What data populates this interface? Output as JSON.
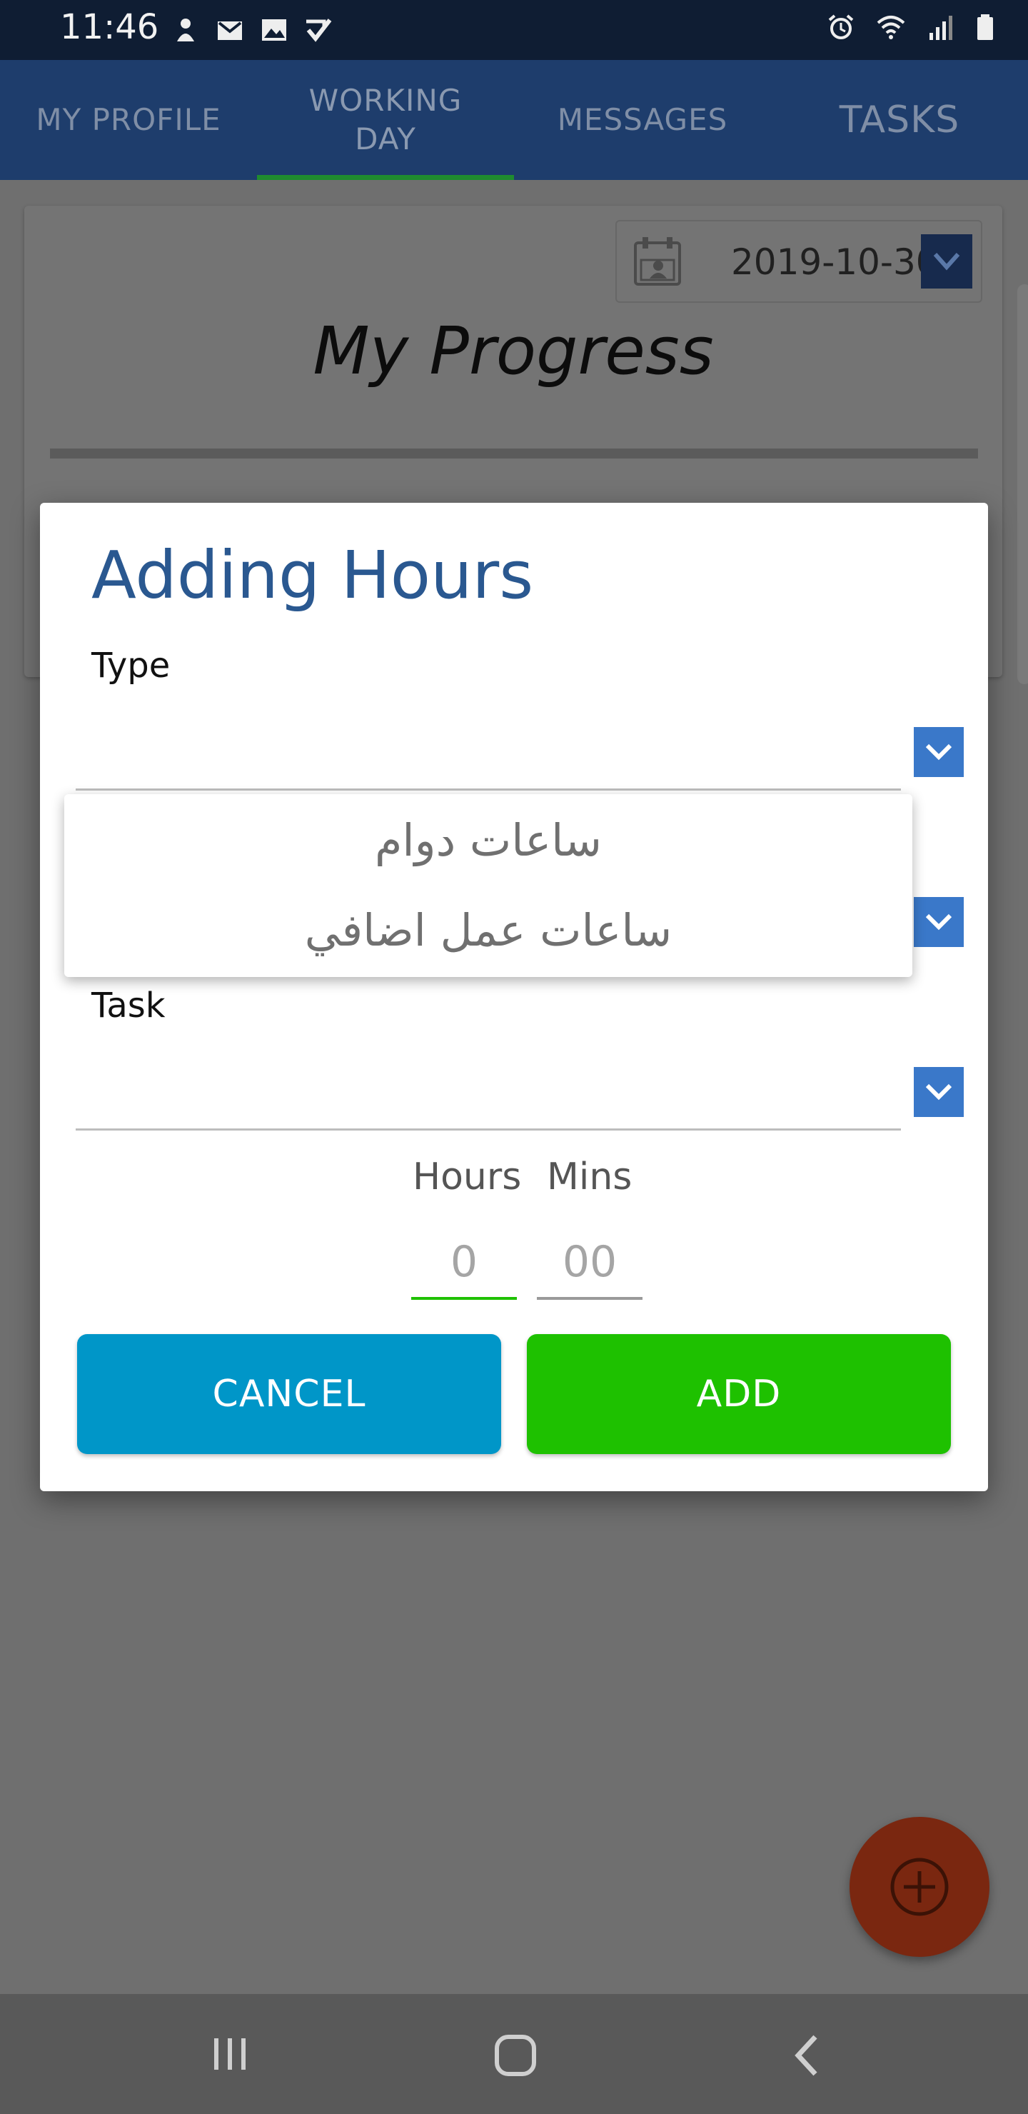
{
  "status_bar": {
    "time": "11:46",
    "left_icons": [
      "person-notification-icon",
      "gmail-icon",
      "image-icon",
      "checkmark-notification-icon"
    ],
    "right_icons": [
      "alarm-icon",
      "wifi-icon",
      "signal-icon",
      "battery-icon"
    ]
  },
  "tabs": [
    {
      "label": "MY PROFILE",
      "active": false
    },
    {
      "label": "WORKING DAY",
      "active": true
    },
    {
      "label": "MESSAGES",
      "active": false
    },
    {
      "label": "TASKS",
      "active": false
    }
  ],
  "progress_card": {
    "date": "2019-10-30",
    "title": "My Progress"
  },
  "dialog": {
    "title": "Adding Hours",
    "type_label": "Type",
    "type_value": "",
    "task_label": "Task",
    "task_value": "",
    "hours_label": "Hours",
    "mins_label": "Mins",
    "hours_placeholder": "0",
    "mins_placeholder": "00",
    "cancel_label": "CANCEL",
    "add_label": "ADD"
  },
  "type_dropdown": {
    "options": [
      "ساعات دوام",
      "ساعات عمل اضافي"
    ]
  },
  "colors": {
    "tab_bar": "#1e3d6c",
    "tab_indicator": "#1f8c2f",
    "dialog_title": "#2a5890",
    "dropdown_button": "#3a78c9",
    "cancel_button": "#0096c8",
    "add_button": "#1ec100",
    "fab": "#d2421a"
  }
}
